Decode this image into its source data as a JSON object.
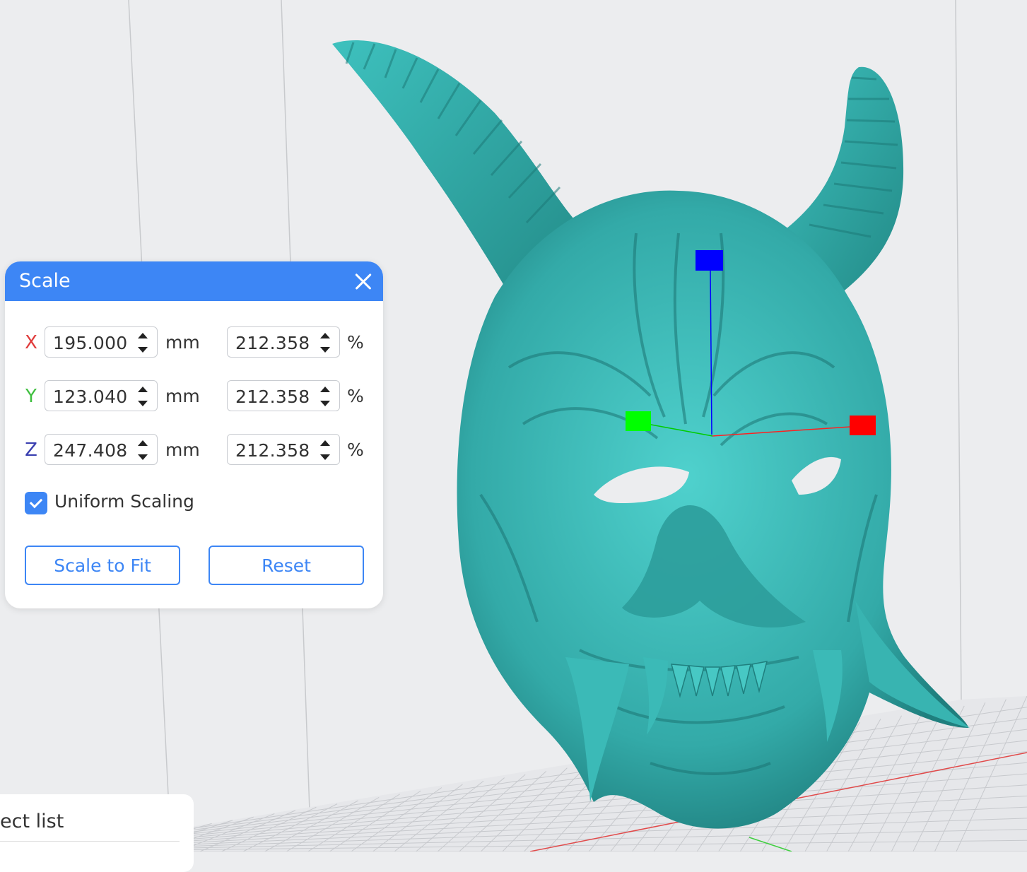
{
  "scale_dialog": {
    "title": "Scale",
    "rows": [
      {
        "axis": "X",
        "axis_color": "#e03b3b",
        "size": "195.000",
        "size_unit": "mm",
        "percent": "212.358",
        "percent_unit": "%"
      },
      {
        "axis": "Y",
        "axis_color": "#3fbf3f",
        "size": "123.040",
        "size_unit": "mm",
        "percent": "212.358",
        "percent_unit": "%"
      },
      {
        "axis": "Z",
        "axis_color": "#3a3fb0",
        "size": "247.408",
        "size_unit": "mm",
        "percent": "212.358",
        "percent_unit": "%"
      }
    ],
    "uniform_scaling": {
      "label": "Uniform Scaling",
      "checked": true
    },
    "scale_to_fit_label": "Scale to Fit",
    "reset_label": "Reset"
  },
  "object_list": {
    "title": "ect list"
  },
  "colors": {
    "accent": "#3d86f5",
    "model": "#36b2b0",
    "background": "#ecedef",
    "gizmo_x": "#ff0000",
    "gizmo_y": "#00ff00",
    "gizmo_z": "#0000ff"
  }
}
